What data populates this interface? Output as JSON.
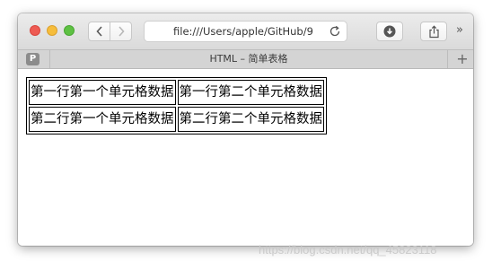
{
  "browser": {
    "url": "file:///Users/apple/GitHub/9",
    "tab_title": "HTML – 简单表格",
    "pinned_tab_letter": "P",
    "new_tab_symbol": "+",
    "overflow_symbol": "»"
  },
  "table": {
    "rows": [
      {
        "cells": [
          "第一行第一个单元格数据",
          "第一行第二个单元格数据"
        ]
      },
      {
        "cells": [
          "第二行第一个单元格数据",
          "第二行第二个单元格数据"
        ]
      }
    ]
  },
  "watermark": "https://blog.csdn.net/qq_45823118",
  "colors": {
    "close": "#ee5b53",
    "minimize": "#f6bd3b",
    "maximize": "#5ec143"
  },
  "icons": [
    "back-arrow-icon",
    "forward-arrow-icon",
    "reload-icon",
    "download-icon",
    "share-icon"
  ]
}
